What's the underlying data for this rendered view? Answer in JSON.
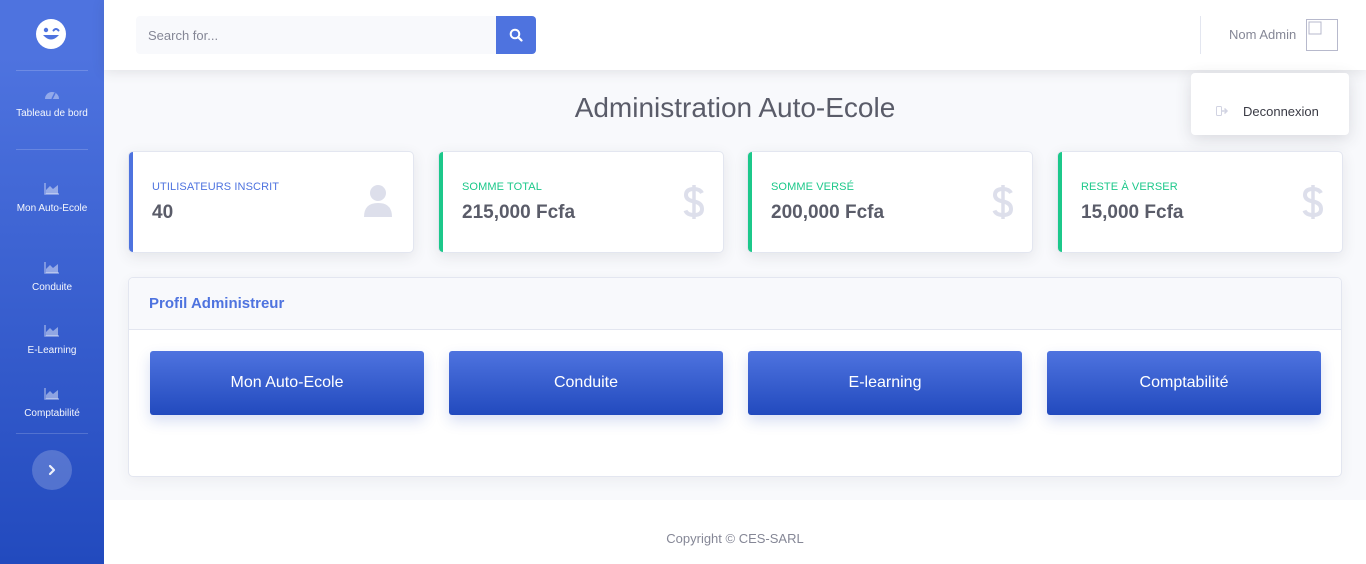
{
  "sidebar": {
    "items": [
      {
        "label": "Tableau de bord",
        "icon": "tachometer-icon"
      },
      {
        "label": "Mon Auto-Ecole",
        "icon": "chart-area-icon"
      },
      {
        "label": "Conduite",
        "icon": "chart-area-icon"
      },
      {
        "label": "E-Learning",
        "icon": "chart-area-icon"
      },
      {
        "label": "Comptabilité",
        "icon": "chart-area-icon"
      }
    ]
  },
  "topbar": {
    "search_placeholder": "Search for...",
    "user_name": "Nom Admin"
  },
  "dropdown": {
    "logout_label": "Deconnexion"
  },
  "main": {
    "title": "Administration Auto-Ecole"
  },
  "cards": [
    {
      "label": "Utilisateurs inscrit",
      "value": "40",
      "color": "#4e73df",
      "icon": "user-icon"
    },
    {
      "label": "Somme total",
      "value": "215,000 Fcfa",
      "color": "#1cc88a",
      "icon": "dollar-icon"
    },
    {
      "label": "Somme versé",
      "value": "200,000 Fcfa",
      "color": "#1cc88a",
      "icon": "dollar-icon"
    },
    {
      "label": "Reste à verser",
      "value": "15,000 Fcfa",
      "color": "#1cc88a",
      "icon": "dollar-icon"
    }
  ],
  "panel": {
    "title": "Profil Administreur",
    "buttons": [
      "Mon Auto-Ecole",
      "Conduite",
      "E-learning",
      "Comptabilité"
    ]
  },
  "footer": {
    "copyright": "Copyright © CES-SARL"
  },
  "colors": {
    "primary": "#4e73df",
    "primary_dark": "#224abe",
    "success": "#1cc88a",
    "text_gray": "#858796"
  }
}
